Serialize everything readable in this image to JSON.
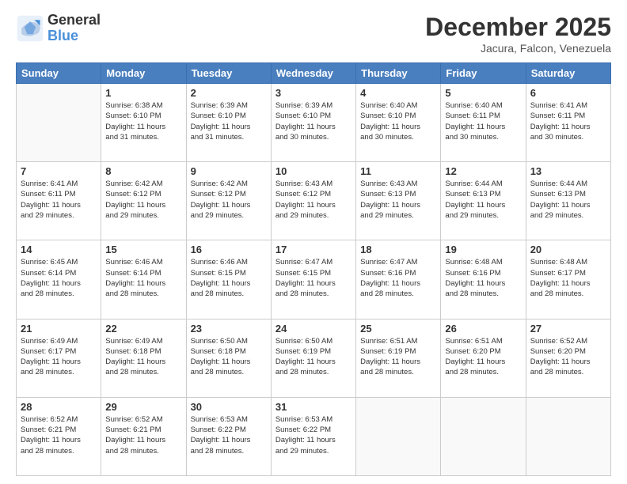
{
  "logo": {
    "general": "General",
    "blue": "Blue"
  },
  "title": "December 2025",
  "location": "Jacura, Falcon, Venezuela",
  "days_of_week": [
    "Sunday",
    "Monday",
    "Tuesday",
    "Wednesday",
    "Thursday",
    "Friday",
    "Saturday"
  ],
  "weeks": [
    [
      {
        "day": "",
        "info": ""
      },
      {
        "day": "1",
        "info": "Sunrise: 6:38 AM\nSunset: 6:10 PM\nDaylight: 11 hours\nand 31 minutes."
      },
      {
        "day": "2",
        "info": "Sunrise: 6:39 AM\nSunset: 6:10 PM\nDaylight: 11 hours\nand 31 minutes."
      },
      {
        "day": "3",
        "info": "Sunrise: 6:39 AM\nSunset: 6:10 PM\nDaylight: 11 hours\nand 30 minutes."
      },
      {
        "day": "4",
        "info": "Sunrise: 6:40 AM\nSunset: 6:10 PM\nDaylight: 11 hours\nand 30 minutes."
      },
      {
        "day": "5",
        "info": "Sunrise: 6:40 AM\nSunset: 6:11 PM\nDaylight: 11 hours\nand 30 minutes."
      },
      {
        "day": "6",
        "info": "Sunrise: 6:41 AM\nSunset: 6:11 PM\nDaylight: 11 hours\nand 30 minutes."
      }
    ],
    [
      {
        "day": "7",
        "info": "Sunrise: 6:41 AM\nSunset: 6:11 PM\nDaylight: 11 hours\nand 29 minutes."
      },
      {
        "day": "8",
        "info": "Sunrise: 6:42 AM\nSunset: 6:12 PM\nDaylight: 11 hours\nand 29 minutes."
      },
      {
        "day": "9",
        "info": "Sunrise: 6:42 AM\nSunset: 6:12 PM\nDaylight: 11 hours\nand 29 minutes."
      },
      {
        "day": "10",
        "info": "Sunrise: 6:43 AM\nSunset: 6:12 PM\nDaylight: 11 hours\nand 29 minutes."
      },
      {
        "day": "11",
        "info": "Sunrise: 6:43 AM\nSunset: 6:13 PM\nDaylight: 11 hours\nand 29 minutes."
      },
      {
        "day": "12",
        "info": "Sunrise: 6:44 AM\nSunset: 6:13 PM\nDaylight: 11 hours\nand 29 minutes."
      },
      {
        "day": "13",
        "info": "Sunrise: 6:44 AM\nSunset: 6:13 PM\nDaylight: 11 hours\nand 29 minutes."
      }
    ],
    [
      {
        "day": "14",
        "info": "Sunrise: 6:45 AM\nSunset: 6:14 PM\nDaylight: 11 hours\nand 28 minutes."
      },
      {
        "day": "15",
        "info": "Sunrise: 6:46 AM\nSunset: 6:14 PM\nDaylight: 11 hours\nand 28 minutes."
      },
      {
        "day": "16",
        "info": "Sunrise: 6:46 AM\nSunset: 6:15 PM\nDaylight: 11 hours\nand 28 minutes."
      },
      {
        "day": "17",
        "info": "Sunrise: 6:47 AM\nSunset: 6:15 PM\nDaylight: 11 hours\nand 28 minutes."
      },
      {
        "day": "18",
        "info": "Sunrise: 6:47 AM\nSunset: 6:16 PM\nDaylight: 11 hours\nand 28 minutes."
      },
      {
        "day": "19",
        "info": "Sunrise: 6:48 AM\nSunset: 6:16 PM\nDaylight: 11 hours\nand 28 minutes."
      },
      {
        "day": "20",
        "info": "Sunrise: 6:48 AM\nSunset: 6:17 PM\nDaylight: 11 hours\nand 28 minutes."
      }
    ],
    [
      {
        "day": "21",
        "info": "Sunrise: 6:49 AM\nSunset: 6:17 PM\nDaylight: 11 hours\nand 28 minutes."
      },
      {
        "day": "22",
        "info": "Sunrise: 6:49 AM\nSunset: 6:18 PM\nDaylight: 11 hours\nand 28 minutes."
      },
      {
        "day": "23",
        "info": "Sunrise: 6:50 AM\nSunset: 6:18 PM\nDaylight: 11 hours\nand 28 minutes."
      },
      {
        "day": "24",
        "info": "Sunrise: 6:50 AM\nSunset: 6:19 PM\nDaylight: 11 hours\nand 28 minutes."
      },
      {
        "day": "25",
        "info": "Sunrise: 6:51 AM\nSunset: 6:19 PM\nDaylight: 11 hours\nand 28 minutes."
      },
      {
        "day": "26",
        "info": "Sunrise: 6:51 AM\nSunset: 6:20 PM\nDaylight: 11 hours\nand 28 minutes."
      },
      {
        "day": "27",
        "info": "Sunrise: 6:52 AM\nSunset: 6:20 PM\nDaylight: 11 hours\nand 28 minutes."
      }
    ],
    [
      {
        "day": "28",
        "info": "Sunrise: 6:52 AM\nSunset: 6:21 PM\nDaylight: 11 hours\nand 28 minutes."
      },
      {
        "day": "29",
        "info": "Sunrise: 6:52 AM\nSunset: 6:21 PM\nDaylight: 11 hours\nand 28 minutes."
      },
      {
        "day": "30",
        "info": "Sunrise: 6:53 AM\nSunset: 6:22 PM\nDaylight: 11 hours\nand 28 minutes."
      },
      {
        "day": "31",
        "info": "Sunrise: 6:53 AM\nSunset: 6:22 PM\nDaylight: 11 hours\nand 29 minutes."
      },
      {
        "day": "",
        "info": ""
      },
      {
        "day": "",
        "info": ""
      },
      {
        "day": "",
        "info": ""
      }
    ]
  ]
}
